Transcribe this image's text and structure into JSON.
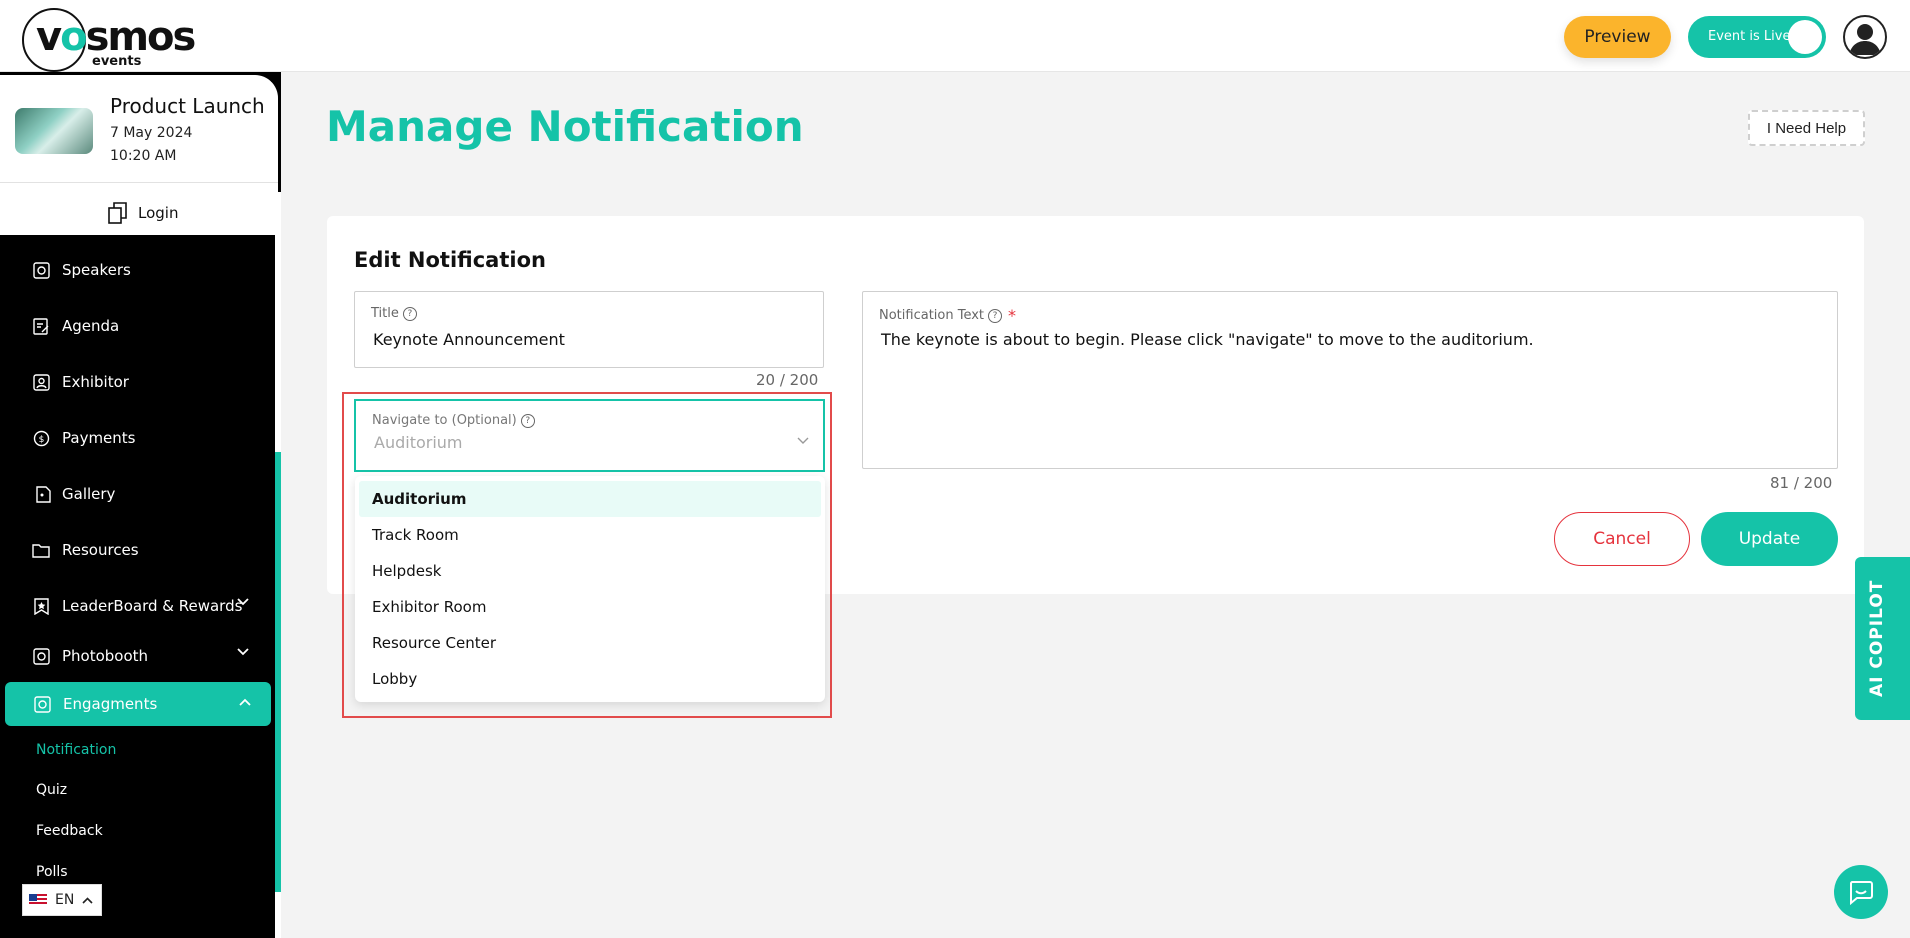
{
  "brand": {
    "name_left": "v",
    "name_dot": "o",
    "name_right": "smos",
    "sub": "events"
  },
  "header": {
    "preview_label": "Preview",
    "live_label": "Event is Live"
  },
  "event": {
    "title": "Product Launch",
    "date": "7 May 2024",
    "time": "10:20 AM",
    "login_label": "Login"
  },
  "sidebar": {
    "items": [
      {
        "label": "Speakers",
        "icon": "speaker-icon"
      },
      {
        "label": "Agenda",
        "icon": "agenda-icon"
      },
      {
        "label": "Exhibitor",
        "icon": "exhibitor-icon"
      },
      {
        "label": "Payments",
        "icon": "payments-icon"
      },
      {
        "label": "Gallery",
        "icon": "gallery-icon"
      },
      {
        "label": "Resources",
        "icon": "folder-icon"
      },
      {
        "label": "LeaderBoard & Rewards",
        "icon": "star-bookmark-icon"
      },
      {
        "label": "Photobooth",
        "icon": "camera-icon"
      },
      {
        "label": "Engagments",
        "icon": "engagement-icon"
      }
    ],
    "sub_items": [
      "Notification",
      "Quiz",
      "Feedback",
      "Polls"
    ],
    "language": "EN"
  },
  "main": {
    "page_title": "Manage Notification",
    "help_label": "I Need Help",
    "card_title": "Edit Notification",
    "title_field": {
      "label": "Title",
      "value": "Keynote Announcement",
      "counter": "20 / 200"
    },
    "text_field": {
      "label": "Notification Text",
      "required_mark": "*",
      "value": "The keynote is about to begin. Please click \"navigate\" to move to the auditorium.",
      "counter": "81 / 200"
    },
    "navigate_field": {
      "label": "Navigate to (Optional)",
      "value": "Auditorium"
    },
    "options": [
      "Auditorium",
      "Track Room",
      "Helpdesk",
      "Exhibitor Room",
      "Resource Center",
      "Lobby"
    ],
    "selected_option": "Auditorium",
    "cancel_label": "Cancel",
    "update_label": "Update"
  },
  "copilot_label": "AI COPILOT",
  "colors": {
    "accent": "#15c3a8",
    "preview": "#fbb42c",
    "danger": "#e5333d"
  }
}
